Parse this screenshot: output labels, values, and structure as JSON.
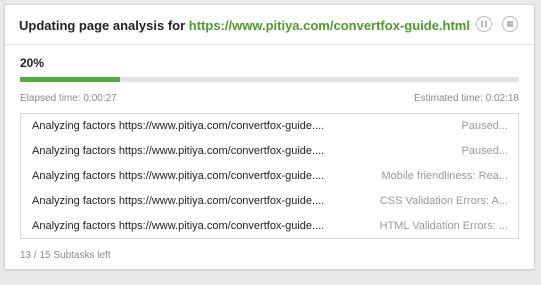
{
  "header": {
    "title_prefix": "Updating page analysis for",
    "url": "https://www.pitiya.com/convertfox-guide.html"
  },
  "progress": {
    "percent_label": "20%",
    "fraction": 0.2,
    "elapsed": "Elapsed time:  0:00:27",
    "estimated": "Estimated time:  0:02:18"
  },
  "subtasks": [
    {
      "name": "Analyzing factors https://www.pitiya.com/convertfox-guide....",
      "status": "Paused..."
    },
    {
      "name": "Analyzing factors https://www.pitiya.com/convertfox-guide....",
      "status": "Paused..."
    },
    {
      "name": "Analyzing factors https://www.pitiya.com/convertfox-guide....",
      "status": "Mobile friendliness: Rea..."
    },
    {
      "name": "Analyzing factors https://www.pitiya.com/convertfox-guide....",
      "status": "CSS Validation Errors: A..."
    },
    {
      "name": "Analyzing factors https://www.pitiya.com/convertfox-guide....",
      "status": "HTML Validation Errors: ..."
    }
  ],
  "footer": {
    "subtasks_left": "13 / 15 Subtasks left"
  },
  "colors": {
    "accent": "#53a93f",
    "url": "#4f9a2c"
  },
  "icons": {
    "pause": "pause-icon",
    "stop": "stop-icon"
  }
}
